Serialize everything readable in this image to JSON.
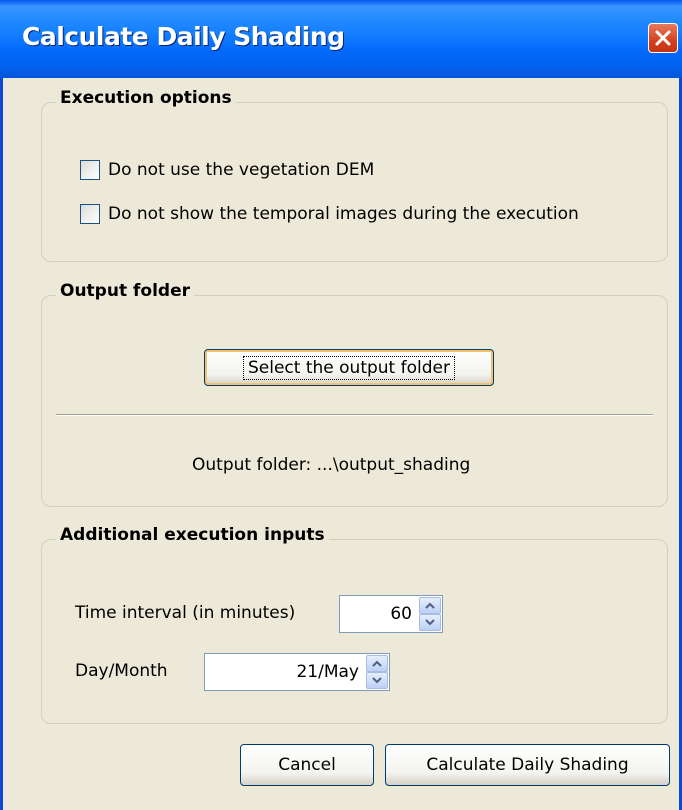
{
  "window": {
    "title": "Calculate Daily Shading"
  },
  "execution_options": {
    "legend": "Execution options",
    "checkboxes": [
      {
        "label": "Do not use the vegetation DEM",
        "checked": false
      },
      {
        "label": "Do not show the temporal images during the execution",
        "checked": false
      }
    ]
  },
  "output_folder": {
    "legend": "Output folder",
    "select_button": "Select the output folder",
    "status": "Output folder: ...\\output_shading"
  },
  "additional_inputs": {
    "legend": "Additional execution inputs",
    "time_interval_label": "Time interval (in minutes)",
    "time_interval_value": "60",
    "day_month_label": "Day/Month",
    "day_month_value": "21/May"
  },
  "footer": {
    "cancel": "Cancel",
    "calculate": "Calculate Daily Shading"
  },
  "colors": {
    "titlebar": "#0a5fe6",
    "window_bg": "#ece9d8",
    "close_button": "#d3421f"
  }
}
